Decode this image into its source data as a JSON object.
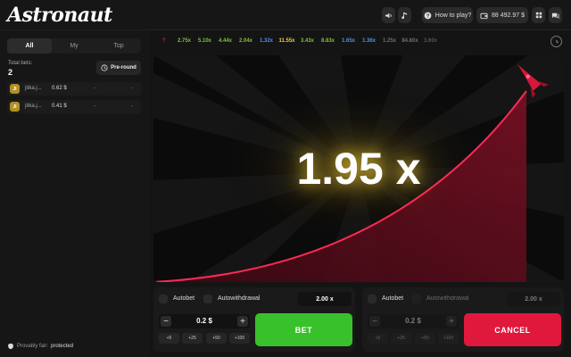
{
  "header": {
    "logo": "Astronaut",
    "how_to_play": "How to play?",
    "balance": "88 492.97 $",
    "colors": {
      "accent_green": "#39c12b",
      "accent_red": "#e0183c"
    }
  },
  "sidebar": {
    "tabs": [
      {
        "label": "All"
      },
      {
        "label": "My"
      },
      {
        "label": "Top"
      }
    ],
    "total_bets_label": "Total bets:",
    "total_bets_value": "2",
    "preround_label": "Pre-round",
    "bets": [
      {
        "avatar": "JI",
        "name": "jitka.j...",
        "amount": "0.62 $",
        "col1": "-",
        "col2": "-"
      },
      {
        "avatar": "JI",
        "name": "jitka.j...",
        "amount": "0.41 $",
        "col1": "-",
        "col2": "-"
      }
    ],
    "provably_fair_label": "Provably fair:",
    "provably_fair_value": "protected"
  },
  "history": [
    {
      "value": "?",
      "color": "#e0183c"
    },
    {
      "value": "2.75x",
      "color": "#7cc23a"
    },
    {
      "value": "5.10x",
      "color": "#7cc23a"
    },
    {
      "value": "4.44x",
      "color": "#7cc23a"
    },
    {
      "value": "2.04x",
      "color": "#7cc23a"
    },
    {
      "value": "1.32x",
      "color": "#4f8ee8"
    },
    {
      "value": "11.55x",
      "color": "#e7d33a"
    },
    {
      "value": "3.43x",
      "color": "#7cc23a"
    },
    {
      "value": "8.83x",
      "color": "#7cc23a"
    },
    {
      "value": "1.65x",
      "color": "#4f8ee8"
    },
    {
      "value": "1.36x",
      "color": "#4f8ee8"
    },
    {
      "value": "1.25x",
      "color": "#6f6f6f"
    },
    {
      "value": "84.80x",
      "color": "#6f6f6f"
    },
    {
      "value": "3.60x",
      "color": "#555555"
    }
  ],
  "game": {
    "multiplier": "1.95 x"
  },
  "panels": [
    {
      "autobet": "Autobet",
      "autowithdrawal": "Autowithdrawal",
      "multiplier": "2.00 x",
      "stake": "0.2 $",
      "minus": "−",
      "plus": "+",
      "quick": [
        "+5",
        "+25",
        "+50",
        "+100"
      ],
      "action": "BET"
    },
    {
      "autobet": "Autobet",
      "autowithdrawal": "Autowithdrawal",
      "multiplier": "2.00 x",
      "stake": "0.2 $",
      "minus": "−",
      "plus": "+",
      "quick": [
        "+5",
        "+25",
        "+50",
        "+100"
      ],
      "action": "CANCEL"
    }
  ]
}
